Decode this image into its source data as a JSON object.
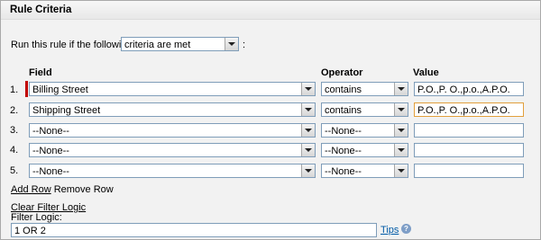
{
  "panel": {
    "title": "Rule Criteria"
  },
  "run": {
    "label": "Run this rule if the following",
    "selected": "criteria are met",
    "colon": ":"
  },
  "columns": {
    "field": "Field",
    "operator": "Operator",
    "value": "Value"
  },
  "rows": [
    {
      "num": "1.",
      "field": "Billing Street",
      "operator": "contains",
      "value": "P.O.,P. O.,p.o.,A.P.O."
    },
    {
      "num": "2.",
      "field": "Shipping Street",
      "operator": "contains",
      "value": "P.O.,P. O.,p.o.,A.P.O."
    },
    {
      "num": "3.",
      "field": "--None--",
      "operator": "--None--",
      "value": ""
    },
    {
      "num": "4.",
      "field": "--None--",
      "operator": "--None--",
      "value": ""
    },
    {
      "num": "5.",
      "field": "--None--",
      "operator": "--None--",
      "value": ""
    }
  ],
  "actions": {
    "add_row": "Add Row",
    "remove_row": "Remove Row"
  },
  "filter_logic": {
    "clear_label": "Clear Filter Logic",
    "label": "Filter Logic:",
    "value": "1 OR 2",
    "tips": "Tips",
    "help_glyph": "?"
  },
  "colors": {
    "required_bar": "#c00000",
    "focus_border": "#e2a03c",
    "link_blue": "#015ba7"
  },
  "icons": {
    "dropdown": "chevron-down-icon",
    "help": "help-icon"
  }
}
